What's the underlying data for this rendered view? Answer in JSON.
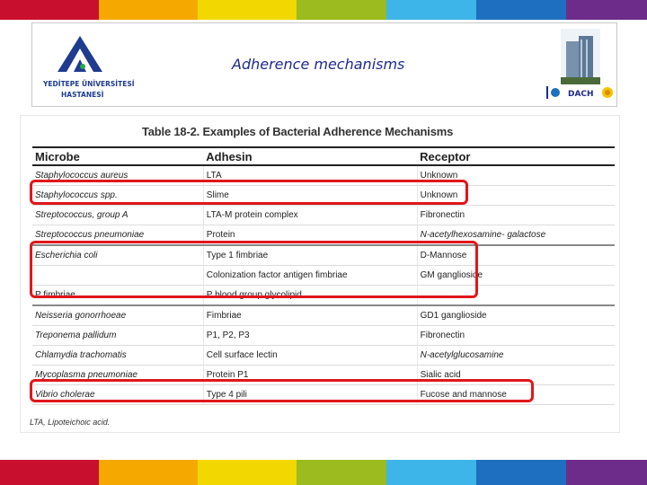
{
  "colors": {
    "stripe": [
      "#c8102e",
      "#f5a800",
      "#f2d800",
      "#9bbb1e",
      "#3eb5e8",
      "#1e6fbf",
      "#6d2c8a"
    ],
    "highlight": "#e0161b",
    "title": "#1e2a8a"
  },
  "header": {
    "logo_text_1": "YEDİTEPE ÜNİVERSİTESİ",
    "logo_text_2": "HASTANESİ",
    "title": "Adherence mechanisms",
    "partner_text": "DACH"
  },
  "table": {
    "title": "Table 18-2. Examples of Bacterial Adherence Mechanisms",
    "headers": [
      "Microbe",
      "Adhesin",
      "Receptor"
    ],
    "rows": [
      [
        "Staphylococcus aureus",
        "LTA",
        "Unknown"
      ],
      [
        "Staphylococcus spp.",
        "Slime",
        "Unknown"
      ],
      [
        "Streptococcus, group A",
        "LTA-M protein complex",
        "Fibronectin"
      ],
      [
        "Streptococcus pneumoniae",
        "Protein",
        "N-acetylhexosamine- galactose"
      ],
      [
        "Escherichia coli",
        "Type 1 fimbriae",
        "D-Mannose"
      ],
      [
        "",
        "Colonization factor antigen fimbriae",
        "GM ganglioside"
      ],
      [
        "P fimbriae",
        "P blood group glycolipid",
        ""
      ],
      [
        "Neisseria gonorrhoeae",
        "Fimbriae",
        "GD1 ganglioside"
      ],
      [
        "Treponema pallidum",
        "P1, P2, P3",
        "Fibronectin"
      ],
      [
        "Chlamydia trachomatis",
        "Cell surface lectin",
        "N-acetylglucosamine"
      ],
      [
        "Mycoplasma pneumoniae",
        "Protein P1",
        "Sialic acid"
      ],
      [
        "Vibrio cholerae",
        "Type 4 pili",
        "Fucose and mannose"
      ]
    ],
    "footnote": "LTA, Lipoteichoic acid."
  }
}
